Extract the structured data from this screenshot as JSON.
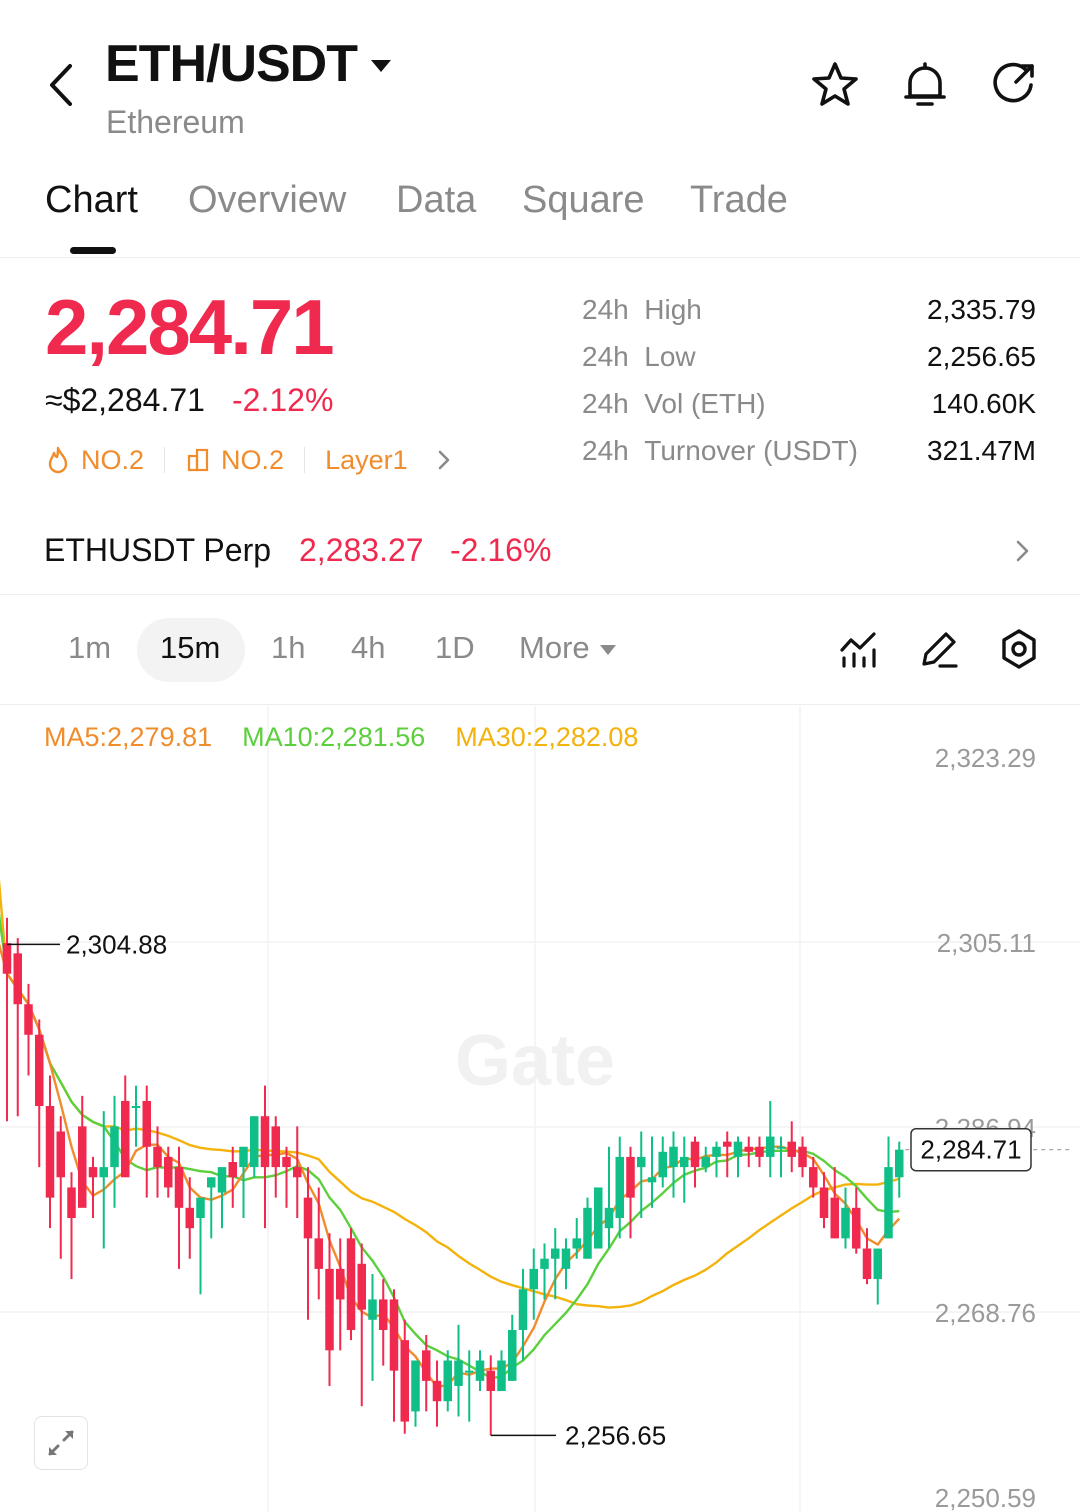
{
  "header": {
    "pair": "ETH/USDT",
    "subtitle": "Ethereum"
  },
  "tabs": [
    "Chart",
    "Overview",
    "Data",
    "Square",
    "Trade"
  ],
  "price": {
    "last": "2,284.71",
    "approx": "≈$2,284.71",
    "change": "-2.12%"
  },
  "tags": [
    {
      "icon": "flame-icon",
      "label": "NO.2"
    },
    {
      "icon": "building-icon",
      "label": "NO.2"
    },
    {
      "icon": "",
      "label": "Layer1"
    }
  ],
  "stats": [
    {
      "prefix": "24h",
      "label": "High",
      "value": "2,335.79"
    },
    {
      "prefix": "24h",
      "label": "Low",
      "value": "2,256.65"
    },
    {
      "prefix": "24h",
      "label": "Vol (ETH)",
      "value": "140.60K"
    },
    {
      "prefix": "24h",
      "label": "Turnover (USDT)",
      "value": "321.47M"
    }
  ],
  "perp": {
    "name": "ETHUSDT Perp",
    "price": "2,283.27",
    "change": "-2.16%"
  },
  "intervals": [
    "1m",
    "15m",
    "1h",
    "4h",
    "1D",
    "More"
  ],
  "selected_interval": "15m",
  "colors": {
    "up": "#f0294f",
    "down": "#0fbf87",
    "ma5": "#f08c2c",
    "ma10": "#5ccf3c",
    "ma30": "#f3b20c"
  },
  "chart": {
    "ma": [
      {
        "label": "MA5:2,279.81",
        "color": "#f08c2c"
      },
      {
        "label": "MA10:2,281.56",
        "color": "#5ccf3c"
      },
      {
        "label": "MA30:2,282.08",
        "color": "#f3b20c"
      }
    ],
    "y_ticks": [
      "2,323.29",
      "2,305.11",
      "2,286.94",
      "2,268.76",
      "2,250.59"
    ],
    "high_marker": "2,304.88",
    "low_marker": "2,256.65",
    "last_label": "2,284.71",
    "watermark": "Gate"
  },
  "chart_data": {
    "type": "candlestick",
    "ylim": [
      2250.59,
      2323.29
    ],
    "y_ticks": [
      2323.29,
      2305.11,
      2286.94,
      2268.76,
      2250.59
    ],
    "candles": [
      {
        "o": 2305.0,
        "h": 2307.5,
        "l": 2287.5,
        "c": 2302.0
      },
      {
        "o": 2304.0,
        "h": 2305.5,
        "l": 2288.0,
        "c": 2299.0
      },
      {
        "o": 2299.0,
        "h": 2301.0,
        "l": 2292.0,
        "c": 2296.0
      },
      {
        "o": 2296.0,
        "h": 2297.5,
        "l": 2283.0,
        "c": 2289.0
      },
      {
        "o": 2289.0,
        "h": 2292.0,
        "l": 2277.0,
        "c": 2280.0
      },
      {
        "o": 2286.5,
        "h": 2288.0,
        "l": 2274.0,
        "c": 2282.0
      },
      {
        "o": 2281.0,
        "h": 2282.5,
        "l": 2272.0,
        "c": 2278.0
      },
      {
        "o": 2287.0,
        "h": 2290.0,
        "l": 2282.0,
        "c": 2279.0
      },
      {
        "o": 2283.0,
        "h": 2284.0,
        "l": 2278.0,
        "c": 2282.0
      },
      {
        "o": 2282.0,
        "h": 2288.5,
        "l": 2275.0,
        "c": 2283.0
      },
      {
        "o": 2283.0,
        "h": 2290.0,
        "l": 2279.0,
        "c": 2287.0
      },
      {
        "o": 2289.5,
        "h": 2292.0,
        "l": 2286.5,
        "c": 2282.0
      },
      {
        "o": 2289.0,
        "h": 2291.0,
        "l": 2285.0,
        "c": 2289.0
      },
      {
        "o": 2289.5,
        "h": 2291.0,
        "l": 2280.0,
        "c": 2285.0
      },
      {
        "o": 2285.0,
        "h": 2287.0,
        "l": 2280.0,
        "c": 2283.0
      },
      {
        "o": 2284.0,
        "h": 2285.0,
        "l": 2280.0,
        "c": 2281.0
      },
      {
        "o": 2283.0,
        "h": 2285.0,
        "l": 2273.0,
        "c": 2279.0
      },
      {
        "o": 2279.0,
        "h": 2282.0,
        "l": 2274.0,
        "c": 2277.0
      },
      {
        "o": 2278.0,
        "h": 2279.0,
        "l": 2270.5,
        "c": 2280.0
      },
      {
        "o": 2281.0,
        "h": 2282.0,
        "l": 2276.0,
        "c": 2282.0
      },
      {
        "o": 2280.5,
        "h": 2282.5,
        "l": 2277.0,
        "c": 2283.0
      },
      {
        "o": 2283.5,
        "h": 2285.0,
        "l": 2279.0,
        "c": 2282.0
      },
      {
        "o": 2283.0,
        "h": 2284.0,
        "l": 2278.0,
        "c": 2285.0
      },
      {
        "o": 2283.0,
        "h": 2288.0,
        "l": 2282.0,
        "c": 2288.0
      },
      {
        "o": 2288.0,
        "h": 2291.0,
        "l": 2277.0,
        "c": 2283.0
      },
      {
        "o": 2287.0,
        "h": 2288.0,
        "l": 2280.0,
        "c": 2283.0
      },
      {
        "o": 2284.0,
        "h": 2285.0,
        "l": 2279.0,
        "c": 2283.0
      },
      {
        "o": 2283.0,
        "h": 2287.0,
        "l": 2278.0,
        "c": 2282.0
      },
      {
        "o": 2280.0,
        "h": 2283.0,
        "l": 2268.0,
        "c": 2276.0
      },
      {
        "o": 2276.0,
        "h": 2281.0,
        "l": 2270.0,
        "c": 2273.0
      },
      {
        "o": 2273.0,
        "h": 2276.5,
        "l": 2261.5,
        "c": 2265.0
      },
      {
        "o": 2273.0,
        "h": 2276.0,
        "l": 2265.0,
        "c": 2270.0
      },
      {
        "o": 2276.0,
        "h": 2277.0,
        "l": 2266.0,
        "c": 2267.0
      },
      {
        "o": 2273.5,
        "h": 2275.5,
        "l": 2259.5,
        "c": 2269.0
      },
      {
        "o": 2268.0,
        "h": 2272.5,
        "l": 2262.0,
        "c": 2270.0
      },
      {
        "o": 2270.0,
        "h": 2272.0,
        "l": 2263.5,
        "c": 2267.0
      },
      {
        "o": 2270.0,
        "h": 2271.0,
        "l": 2258.0,
        "c": 2263.0
      },
      {
        "o": 2266.0,
        "h": 2268.0,
        "l": 2256.8,
        "c": 2258.0
      },
      {
        "o": 2259.0,
        "h": 2260.0,
        "l": 2257.5,
        "c": 2264.0
      },
      {
        "o": 2265.0,
        "h": 2266.5,
        "l": 2259.0,
        "c": 2262.0
      },
      {
        "o": 2262.0,
        "h": 2264.0,
        "l": 2257.5,
        "c": 2260.0
      },
      {
        "o": 2260.0,
        "h": 2265.0,
        "l": 2259.0,
        "c": 2264.0
      },
      {
        "o": 2261.5,
        "h": 2267.5,
        "l": 2258.5,
        "c": 2264.0
      },
      {
        "o": 2263.0,
        "h": 2265.0,
        "l": 2258.0,
        "c": 2263.0
      },
      {
        "o": 2262.0,
        "h": 2265.0,
        "l": 2261.0,
        "c": 2264.0
      },
      {
        "o": 2263.0,
        "h": 2264.5,
        "l": 2256.65,
        "c": 2261.0
      },
      {
        "o": 2261.0,
        "h": 2265.0,
        "l": 2261.0,
        "c": 2264.0
      },
      {
        "o": 2262.0,
        "h": 2268.5,
        "l": 2262.0,
        "c": 2267.0
      },
      {
        "o": 2267.0,
        "h": 2273.0,
        "l": 2264.0,
        "c": 2271.0
      },
      {
        "o": 2271.0,
        "h": 2275.0,
        "l": 2268.0,
        "c": 2273.0
      },
      {
        "o": 2273.0,
        "h": 2275.5,
        "l": 2270.0,
        "c": 2274.0
      },
      {
        "o": 2274.0,
        "h": 2277.0,
        "l": 2270.0,
        "c": 2275.0
      },
      {
        "o": 2273.0,
        "h": 2276.0,
        "l": 2271.0,
        "c": 2275.0
      },
      {
        "o": 2275.0,
        "h": 2278.0,
        "l": 2274.0,
        "c": 2276.0
      },
      {
        "o": 2274.0,
        "h": 2280.0,
        "l": 2274.0,
        "c": 2279.0
      },
      {
        "o": 2275.0,
        "h": 2281.0,
        "l": 2275.0,
        "c": 2281.0
      },
      {
        "o": 2277.0,
        "h": 2285.0,
        "l": 2275.0,
        "c": 2279.0
      },
      {
        "o": 2278.0,
        "h": 2286.0,
        "l": 2276.0,
        "c": 2284.0
      },
      {
        "o": 2284.0,
        "h": 2285.0,
        "l": 2276.0,
        "c": 2280.0
      },
      {
        "o": 2283.0,
        "h": 2286.5,
        "l": 2278.0,
        "c": 2284.0
      },
      {
        "o": 2281.5,
        "h": 2286.0,
        "l": 2279.0,
        "c": 2282.0
      },
      {
        "o": 2282.0,
        "h": 2286.0,
        "l": 2281.0,
        "c": 2284.5
      },
      {
        "o": 2283.0,
        "h": 2286.5,
        "l": 2280.0,
        "c": 2285.0
      },
      {
        "o": 2283.0,
        "h": 2286.0,
        "l": 2279.5,
        "c": 2284.0
      },
      {
        "o": 2285.5,
        "h": 2286.0,
        "l": 2281.0,
        "c": 2283.0
      },
      {
        "o": 2283.0,
        "h": 2285.0,
        "l": 2282.5,
        "c": 2284.0
      },
      {
        "o": 2284.0,
        "h": 2285.5,
        "l": 2282.0,
        "c": 2285.0
      },
      {
        "o": 2285.5,
        "h": 2286.5,
        "l": 2282.0,
        "c": 2285.0
      },
      {
        "o": 2284.0,
        "h": 2286.0,
        "l": 2282.0,
        "c": 2285.5
      },
      {
        "o": 2285.0,
        "h": 2286.0,
        "l": 2283.0,
        "c": 2284.5
      },
      {
        "o": 2285.0,
        "h": 2286.0,
        "l": 2283.0,
        "c": 2284.0
      },
      {
        "o": 2284.0,
        "h": 2289.5,
        "l": 2282.0,
        "c": 2286.0
      },
      {
        "o": 2285.0,
        "h": 2286.0,
        "l": 2282.0,
        "c": 2285.0
      },
      {
        "o": 2285.5,
        "h": 2287.5,
        "l": 2282.5,
        "c": 2284.0
      },
      {
        "o": 2285.0,
        "h": 2286.0,
        "l": 2282.0,
        "c": 2283.0
      },
      {
        "o": 2283.0,
        "h": 2284.0,
        "l": 2280.0,
        "c": 2281.0
      },
      {
        "o": 2281.0,
        "h": 2282.5,
        "l": 2277.0,
        "c": 2278.0
      },
      {
        "o": 2280.0,
        "h": 2283.0,
        "l": 2276.0,
        "c": 2276.0
      },
      {
        "o": 2276.0,
        "h": 2281.0,
        "l": 2275.0,
        "c": 2279.0
      },
      {
        "o": 2279.0,
        "h": 2281.0,
        "l": 2274.5,
        "c": 2275.0
      },
      {
        "o": 2275.0,
        "h": 2277.0,
        "l": 2271.5,
        "c": 2272.0
      },
      {
        "o": 2272.0,
        "h": 2274.0,
        "l": 2269.5,
        "c": 2275.0
      },
      {
        "o": 2276.0,
        "h": 2286.0,
        "l": 2276.0,
        "c": 2283.0
      },
      {
        "o": 2282.0,
        "h": 2285.5,
        "l": 2280.0,
        "c": 2284.71
      }
    ]
  }
}
